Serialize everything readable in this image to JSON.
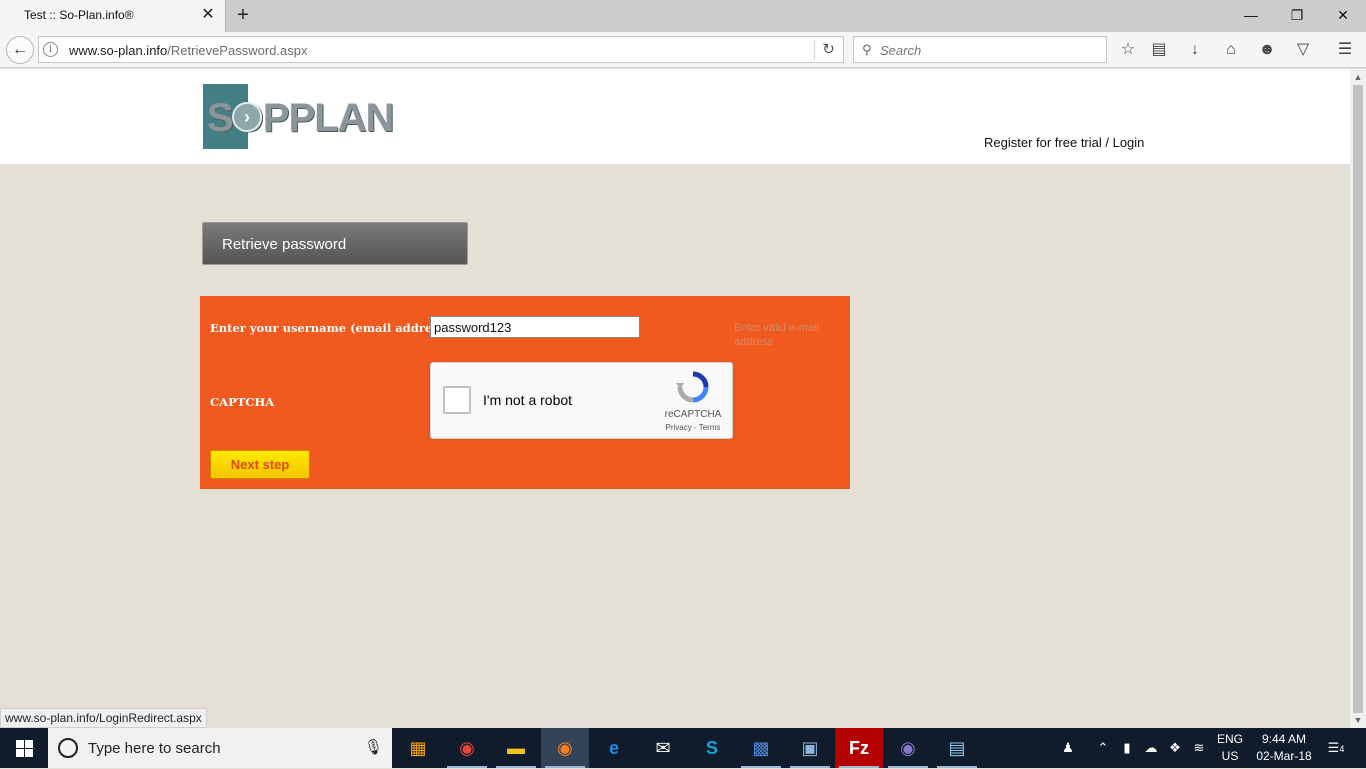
{
  "browser": {
    "tab_title": "Test :: So-Plan.info®",
    "tab_close": "✕",
    "new_tab": "+",
    "url_host": "www.so-plan.info",
    "url_path": "/RetrievePassword.aspx",
    "search_placeholder": "Search",
    "status_url": "www.so-plan.info/LoginRedirect.aspx",
    "window_controls": [
      "minimize-icon",
      "restore-icon",
      "close-icon"
    ],
    "toolbar_icons": [
      "bookmark-star-icon",
      "reading-list-icon",
      "download-icon",
      "home-icon",
      "chat-icon",
      "pocket-icon",
      "menu-icon"
    ]
  },
  "page": {
    "logo_text": "SOPPLAN",
    "header_link": "Register for free trial / Login",
    "section_title": "Retrieve password",
    "form": {
      "username_label": "Enter your username (email address)",
      "username_value": "password123",
      "validation_message": "Enter valid e-mail address",
      "captcha_label": "CAPTCHA",
      "captcha_text": "I'm not a robot",
      "captcha_brand": "reCAPTCHA",
      "captcha_links": "Privacy - Terms",
      "next_button": "Next step"
    },
    "colors": {
      "page_bg": "#e5e0d6",
      "panel": "#f05a1e",
      "button": "#ffea00",
      "title_box": "#666666",
      "logo_teal": "#457f86"
    }
  },
  "taskbar": {
    "search_placeholder": "Type here to search",
    "apps": [
      "store-icon",
      "chrome-icon",
      "file-explorer-icon",
      "firefox-icon",
      "edge-icon",
      "mail-icon",
      "skype-icon",
      "app-icon",
      "virtualbox-icon",
      "filezilla-icon",
      "eclipse-icon",
      "notepad-icon"
    ],
    "language_line1": "ENG",
    "language_line2": "US",
    "time": "9:44 AM",
    "date": "02-Mar-18",
    "notification_count": "4"
  }
}
